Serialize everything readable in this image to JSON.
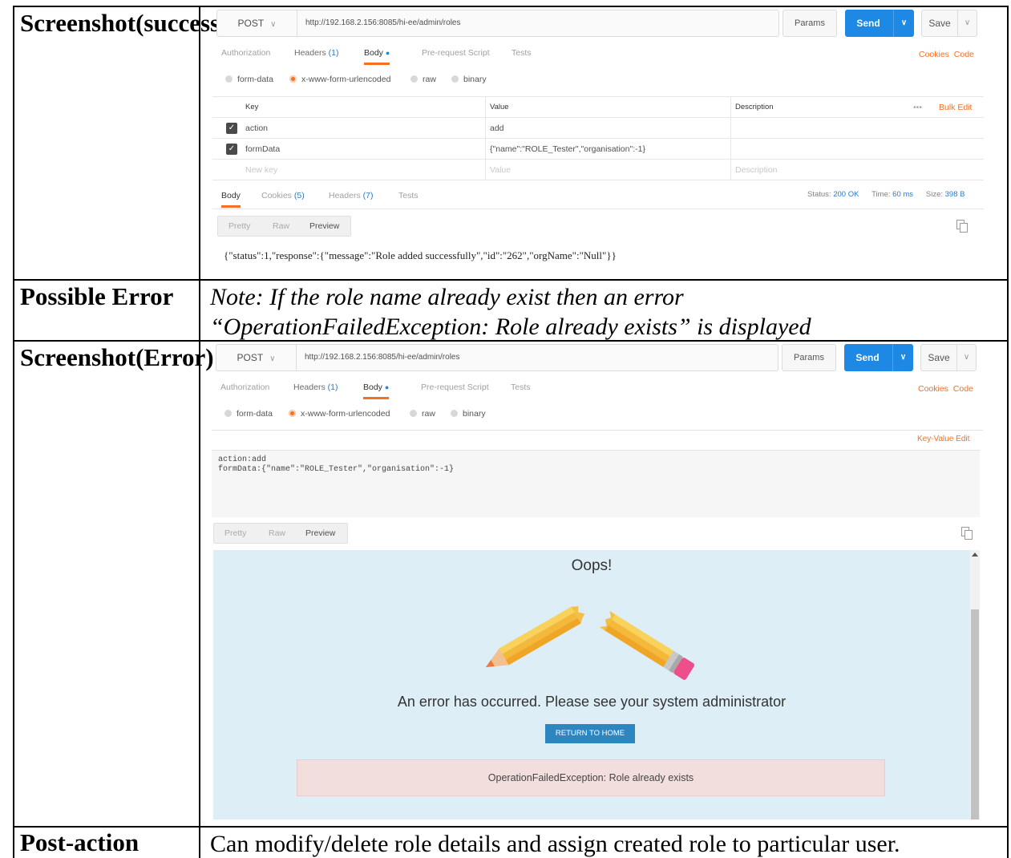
{
  "rows": {
    "success_label": "Screenshot(success)",
    "error_label_row": "Possible Error",
    "error_note_line1": "Note: If the role name already exist then an error",
    "error_note_line2": "“OperationFailedException: Role already exists” is displayed",
    "screenshot_error_label": "Screenshot(Error)",
    "post_action_label": "Post-action",
    "post_action_text": "Can modify/delete role details and assign created role to particular user."
  },
  "success_shot": {
    "method": "POST",
    "url": "http://192.168.2.156:8085/hi-ee/admin/roles",
    "params": "Params",
    "send": "Send",
    "save": "Save",
    "tabs": {
      "authorization": "Authorization",
      "headers": "Headers",
      "headers_count": "(1)",
      "body": "Body",
      "prerequest": "Pre-request Script",
      "tests": "Tests"
    },
    "cookies_link": "Cookies",
    "code_link": "Code",
    "radios": {
      "form_data": "form-data",
      "urlencoded": "x-www-form-urlencoded",
      "raw": "raw",
      "binary": "binary"
    },
    "kv": {
      "header_key": "Key",
      "header_value": "Value",
      "header_desc": "Description",
      "more": "•••",
      "bulk_edit": "Bulk Edit",
      "rows": [
        {
          "key": "action",
          "value": "add"
        },
        {
          "key": "formData",
          "value": "{\"name\":\"ROLE_Tester\",\"organisation\":-1}"
        }
      ],
      "new_key": "New key",
      "new_value": "Value",
      "new_desc": "Description"
    },
    "resp_tabs": {
      "body": "Body",
      "cookies": "Cookies",
      "cookies_count": "(5)",
      "headers": "Headers",
      "headers_count": "(7)",
      "tests": "Tests"
    },
    "status": {
      "status_label": "Status:",
      "status_value": "200 OK",
      "time_label": "Time:",
      "time_value": "60 ms",
      "size_label": "Size:",
      "size_value": "398 B"
    },
    "view": {
      "pretty": "Pretty",
      "raw": "Raw",
      "preview": "Preview"
    },
    "response_body": "{\"status\":1,\"response\":{\"message\":\"Role added successfully\",\"id\":\"262\",\"orgName\":\"Null\"}}"
  },
  "error_shot": {
    "method": "POST",
    "url": "http://192.168.2.156:8085/hi-ee/admin/roles",
    "params": "Params",
    "send": "Send",
    "save": "Save",
    "tabs": {
      "authorization": "Authorization",
      "headers": "Headers",
      "headers_count": "(1)",
      "body": "Body",
      "prerequest": "Pre-request Script",
      "tests": "Tests"
    },
    "cookies_link": "Cookies",
    "code_link": "Code",
    "radios": {
      "form_data": "form-data",
      "urlencoded": "x-www-form-urlencoded",
      "raw": "raw",
      "binary": "binary"
    },
    "key_value_edit": "Key-Value Edit",
    "raw_body_line1": "action:add",
    "raw_body_line2": "formData:{\"name\":\"ROLE_Tester\",\"organisation\":-1}",
    "view": {
      "pretty": "Pretty",
      "raw": "Raw",
      "preview": "Preview"
    },
    "preview": {
      "title": "Oops!",
      "message": "An error has occurred. Please see your system administrator",
      "return_button": "RETURN TO HOME",
      "exception": "OperationFailedException: Role already exists"
    }
  },
  "colors": {
    "accent_orange": "#f47023",
    "send_blue": "#1e88e5",
    "preview_bg": "#ddeef7",
    "error_box_bg": "#f3dede"
  }
}
